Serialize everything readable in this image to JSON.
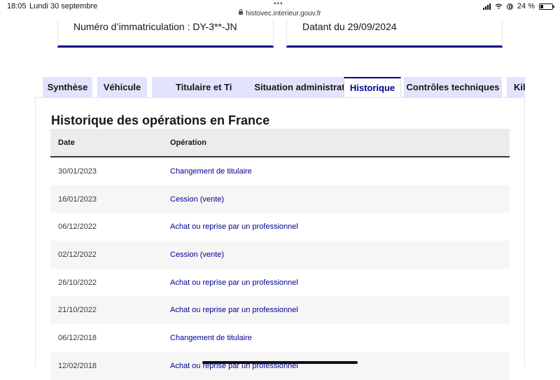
{
  "status_bar": {
    "time": "18:05",
    "date": "Lundi 30 septembre",
    "dots": "•••",
    "url": "histovec.interieur.gouv.fr",
    "battery": "24 %",
    "battery_level": 0.24
  },
  "cards": {
    "left_text": "Numéro d’immatriculation : DY-3**-JN",
    "right_text": "Datant du 29/09/2024"
  },
  "tabs": [
    {
      "label": "Synthèse"
    },
    {
      "label": "Véhicule"
    },
    {
      "label": "Titulaire et Titre"
    },
    {
      "label": "Situation administrative"
    },
    {
      "label": "Historique"
    },
    {
      "label": "Contrôles techniques"
    },
    {
      "label": "Kilo"
    }
  ],
  "active_tab": "Historique",
  "section": {
    "title": "Historique des opérations en France"
  },
  "table": {
    "headers": {
      "date": "Date",
      "operation": "Opération"
    },
    "rows": [
      {
        "date": "30/01/2023",
        "operation": "Changement de titulaire"
      },
      {
        "date": "16/01/2023",
        "operation": "Cession (vente)"
      },
      {
        "date": "06/12/2022",
        "operation": "Achat ou reprise par un professionnel"
      },
      {
        "date": "02/12/2022",
        "operation": "Cession (vente)"
      },
      {
        "date": "26/10/2022",
        "operation": "Achat ou reprise par un professionnel"
      },
      {
        "date": "21/10/2022",
        "operation": "Achat ou reprise par un professionnel"
      },
      {
        "date": "06/12/2018",
        "operation": "Changement de titulaire"
      },
      {
        "date": "12/02/2018",
        "operation": "Achat ou reprise par un professionnel"
      }
    ]
  },
  "colors": {
    "accent": "#000091",
    "tab_bg": "#e3e3fd",
    "row_alt": "#f6f6f6",
    "header_bg": "#ececec"
  }
}
